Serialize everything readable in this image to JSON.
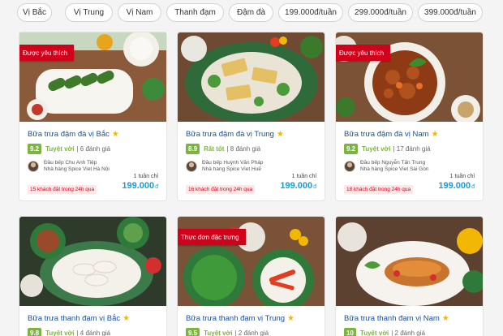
{
  "filters": [
    "Vị Bắc",
    "Vị Trung",
    "Vị Nam",
    "Thanh đạm",
    "Đậm đà",
    "199.000đ/tuần",
    "299.000đ/tuần",
    "399.000đ/tuần"
  ],
  "cards": [
    {
      "ribbon": "Được yêu thích",
      "title": "Bữa trưa đậm đà vị Bắc",
      "score": "9.2",
      "verdict": "Tuyệt vời",
      "reviews": "6 đánh giá",
      "chef_name": "Đầu bếp Chu Anh Tiệp",
      "restaurant": "Nhà hàng Spice Viet Hà Nội",
      "price_label": "1 tuần chỉ",
      "price": "199.000",
      "currency": "đ",
      "bookings": "15 khách đặt trong 24h qua"
    },
    {
      "ribbon": "",
      "title": "Bữa trưa đậm đà vị Trung",
      "score": "8.9",
      "verdict": "Rất tốt",
      "reviews": "8 đánh giá",
      "chef_name": "Đầu bếp Huỳnh Văn Pháp",
      "restaurant": "Nhà hàng Spice Viet Huế",
      "price_label": "1 tuần chỉ",
      "price": "199.000",
      "currency": "đ",
      "bookings": "16 khách đặt trong 24h qua"
    },
    {
      "ribbon": "Được yêu thích",
      "title": "Bữa trưa đậm đà vị Nam",
      "score": "9.2",
      "verdict": "Tuyệt vời",
      "reviews": "17 đánh giá",
      "chef_name": "Đầu bếp Nguyễn Tấn Trung",
      "restaurant": "Nhà hàng Spice Viet Sài Gòn",
      "price_label": "1 tuần chỉ",
      "price": "199.000",
      "currency": "đ",
      "bookings": "18 khách đặt trong 24h qua"
    },
    {
      "ribbon": "",
      "title": "Bữa trưa thanh đạm vị Bắc",
      "score": "9.8",
      "verdict": "Tuyệt vời",
      "reviews": "4 đánh giá"
    },
    {
      "ribbon": "Thực đơn đặc trưng",
      "title": "Bữa trưa thanh đạm vị Trung",
      "score": "9.5",
      "verdict": "Tuyệt vời",
      "reviews": "2 đánh giá"
    },
    {
      "ribbon": "",
      "title": "Bữa trưa thanh đạm vị Nam",
      "score": "10",
      "verdict": "Tuyệt vời",
      "reviews": "2 đánh giá"
    }
  ],
  "icons": {
    "star": "star-icon",
    "avatar": "chef-avatar"
  },
  "colors": {
    "accent": "#1a9cd8",
    "ribbon": "#d0021b",
    "score": "#7cb342",
    "title": "#1a4fa0"
  }
}
